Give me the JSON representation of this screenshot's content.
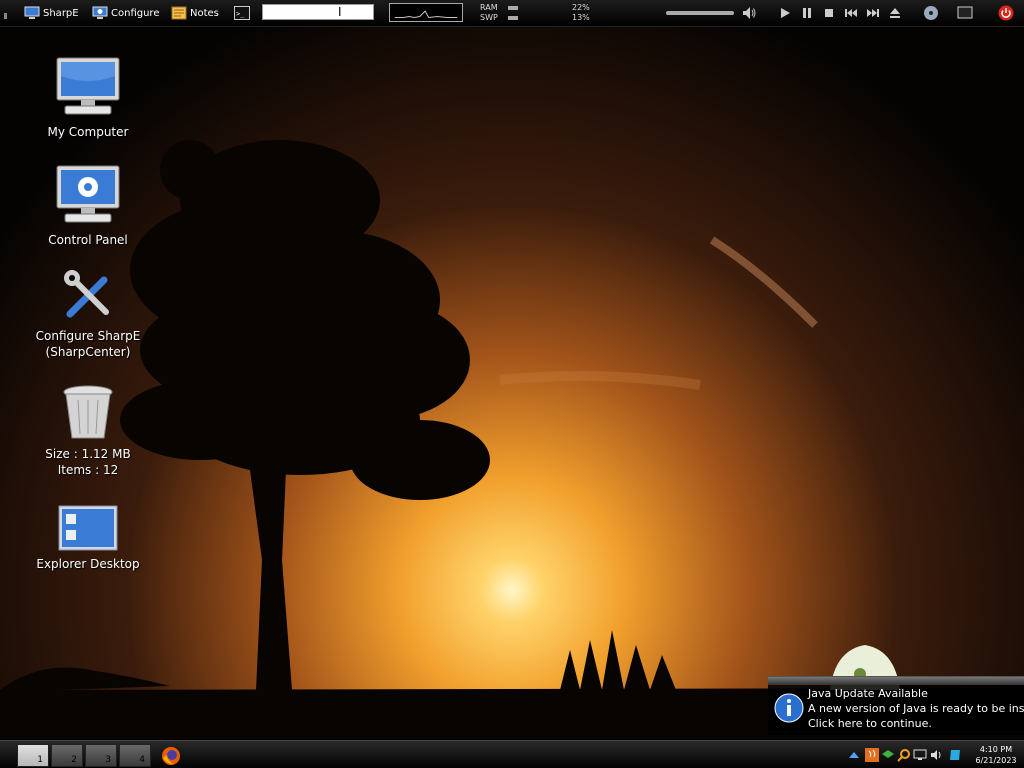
{
  "top_bar": {
    "launchers": {
      "sharpe": "SharpE",
      "configure": "Configure",
      "notes": "Notes",
      "terminal_glyph": ">_"
    },
    "cursor_glyph": "I",
    "memory": {
      "ram_label": "RAM",
      "ram_percent": "22%",
      "swp_label": "SWP",
      "swp_percent": "13%"
    },
    "media_controls": [
      "play",
      "pause",
      "stop",
      "previous",
      "next",
      "eject"
    ]
  },
  "desktop_icons": {
    "my_computer": "My Computer",
    "control_panel": "Control Panel",
    "configure_sharpe_line1": "Configure SharpE",
    "configure_sharpe_line2": "(SharpCenter)",
    "trash_size": "Size : 1.12 MB",
    "trash_items": "Items : 12",
    "explorer_desktop": "Explorer Desktop"
  },
  "notification": {
    "title": "Java Update Available",
    "body": "A new version of Java is ready to be installed.",
    "action": "Click here to continue."
  },
  "taskbar": {
    "workspaces": [
      "1",
      "2",
      "3",
      "4"
    ],
    "active_workspace": "1",
    "tray_icons": [
      "up-arrow-icon",
      "java-icon",
      "network-icon",
      "search-icon",
      "monitor-icon",
      "speaker-icon",
      "app-icon"
    ],
    "clock_time": "4:10 PM",
    "clock_date": "6/21/2023"
  },
  "colors": {
    "sky_top": "#000000",
    "sky_glow": "#e98a1f",
    "sun": "#fff4c0",
    "panel": "#111111",
    "accent_blue": "#3a7bd5",
    "power_red": "#d9261c"
  }
}
